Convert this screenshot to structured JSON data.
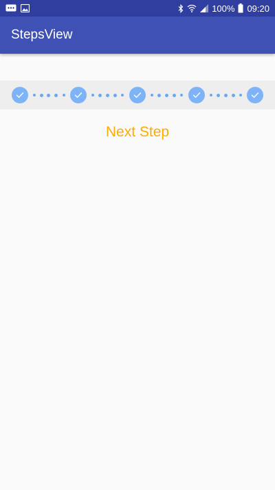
{
  "status_bar": {
    "battery_percent": "100%",
    "time": "09:20",
    "icons": [
      "message-icon",
      "image-icon",
      "bluetooth-icon",
      "wifi-icon",
      "signal-icon",
      "battery-icon"
    ]
  },
  "app_bar": {
    "title": "StepsView"
  },
  "steps": {
    "count": 5,
    "completed": 5,
    "states": [
      "completed",
      "completed",
      "completed",
      "completed",
      "completed"
    ]
  },
  "actions": {
    "next_step_label": "Next Step"
  },
  "colors": {
    "status_bar": "#303f9f",
    "app_bar": "#3f51b5",
    "step_completed": "#7eb4f7",
    "step_connector": "#6aa9f2",
    "strip_background": "#eeeeee",
    "next_step_text": "#ffab00"
  }
}
